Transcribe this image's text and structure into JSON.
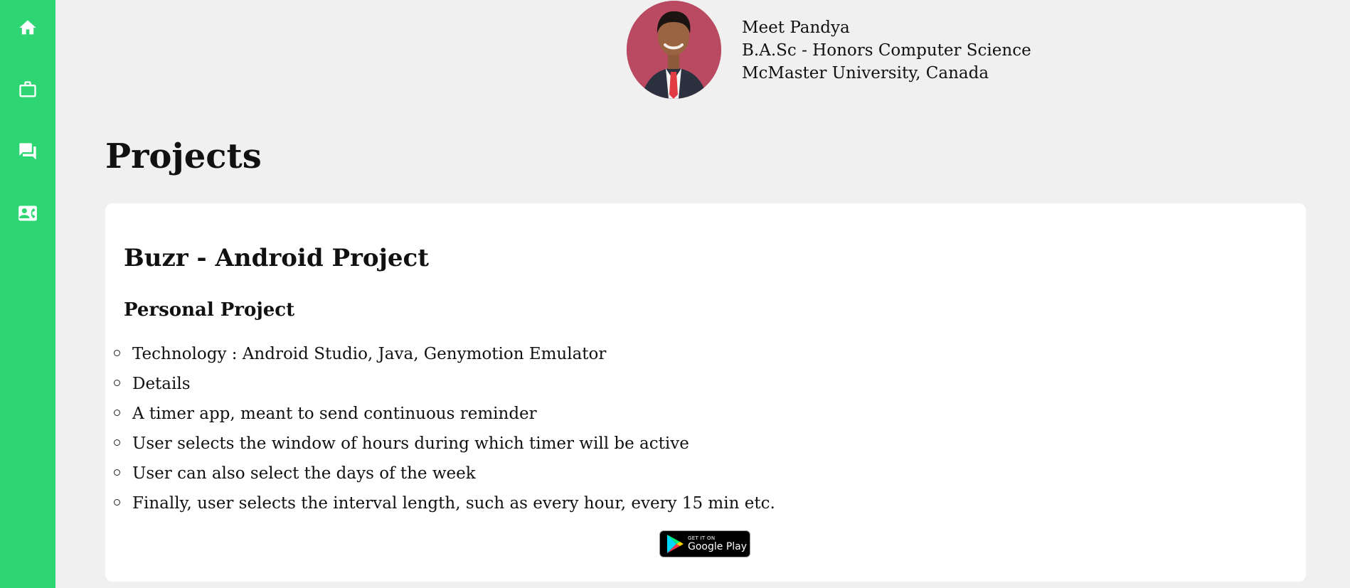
{
  "sidebar": {
    "items": [
      {
        "icon": "home-icon"
      },
      {
        "icon": "briefcase-icon"
      },
      {
        "icon": "chat-icon"
      },
      {
        "icon": "contact-card-icon"
      }
    ],
    "background": "#2ed573"
  },
  "profile": {
    "name": "Meet Pandya",
    "degree": "B.A.Sc - Honors Computer Science",
    "university": "McMaster University, Canada"
  },
  "page": {
    "title": "Projects"
  },
  "project": {
    "title": "Buzr - Android Project",
    "subtitle": "Personal Project",
    "details": [
      "Technology : Android Studio, Java, Genymotion Emulator",
      "Details",
      "A timer app, meant to send continuous reminder",
      "User selects the window of hours during which timer will be active",
      "User can also select the days of the week",
      "Finally, user selects the interval length, such as every hour, every 15 min etc."
    ],
    "store_badge": {
      "small_text": "GET IT ON",
      "big_text": "Google Play"
    }
  }
}
